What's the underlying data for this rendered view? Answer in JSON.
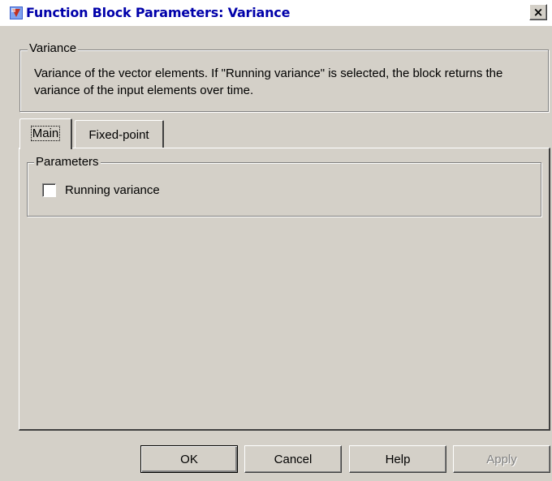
{
  "window": {
    "title": "Function Block Parameters: Variance",
    "close_label": "×"
  },
  "block_group": {
    "label": "Variance",
    "description": "Variance of the vector elements. If \"Running variance\" is selected, the block returns the variance of the input elements over time."
  },
  "tabs": [
    {
      "label": "Main",
      "selected": true
    },
    {
      "label": "Fixed-point",
      "selected": false
    }
  ],
  "parameters": {
    "label": "Parameters",
    "running_variance": {
      "label": "Running variance",
      "checked": false
    }
  },
  "buttons": {
    "ok": "OK",
    "cancel": "Cancel",
    "help": "Help",
    "apply": "Apply",
    "apply_enabled": false
  },
  "icons": {
    "title_icon": "simulink-block-icon",
    "close": "close-icon"
  },
  "colors": {
    "title_text": "#0000aa",
    "dialog_bg": "#d4d0c8",
    "disabled_text": "#808080"
  }
}
